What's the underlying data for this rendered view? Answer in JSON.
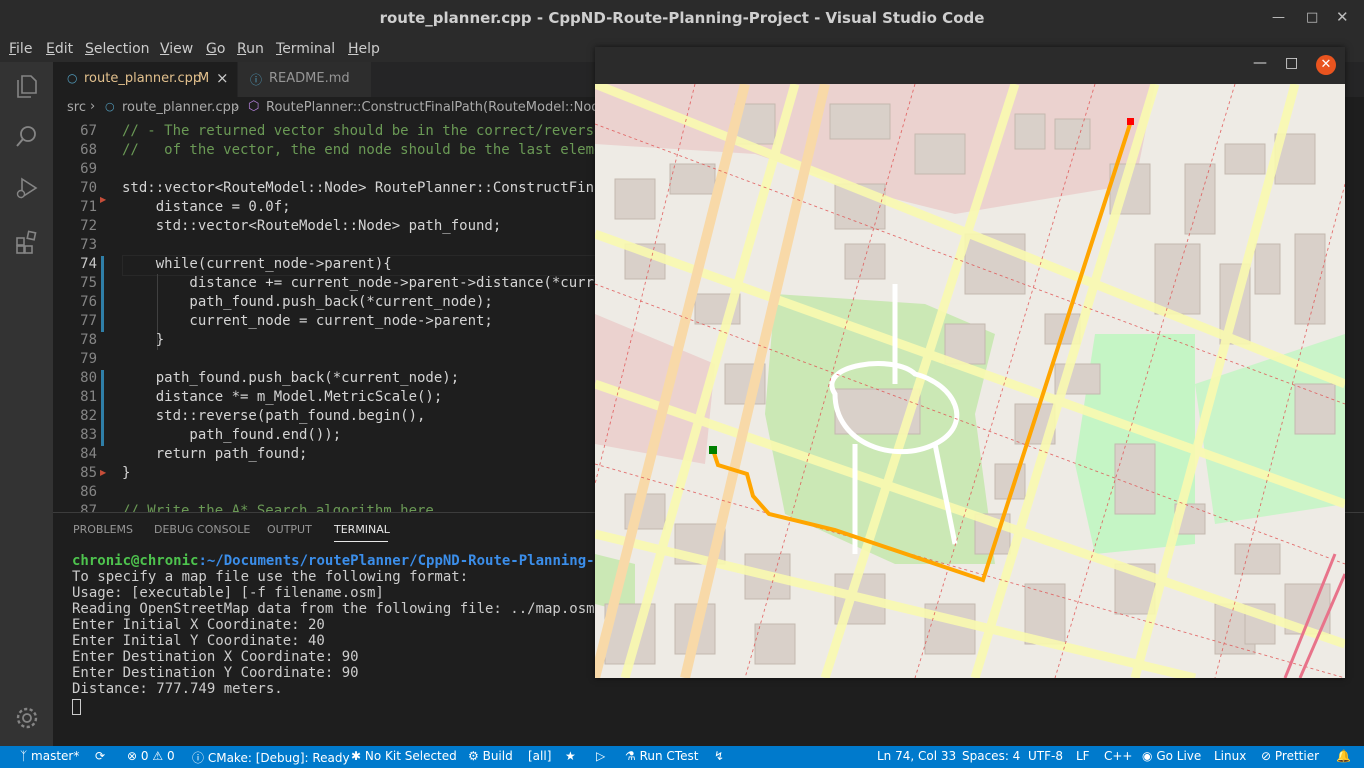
{
  "window": {
    "title": "route_planner.cpp - CppND-Route-Planning-Project - Visual Studio Code"
  },
  "menu": [
    {
      "first": "F",
      "rest": "ile"
    },
    {
      "first": "E",
      "rest": "dit"
    },
    {
      "first": "S",
      "rest": "election"
    },
    {
      "first": "V",
      "rest": "iew"
    },
    {
      "first": "G",
      "rest": "o"
    },
    {
      "first": "R",
      "rest": "un"
    },
    {
      "first": "T",
      "rest": "erminal"
    },
    {
      "first": "H",
      "rest": "elp"
    }
  ],
  "tabs": [
    {
      "label": "route_planner.cpp",
      "badge": "M",
      "close": "×"
    },
    {
      "label": "README.md"
    }
  ],
  "breadcrumb": {
    "folder": "src",
    "file": "route_planner.cpp",
    "symbol": "RoutePlanner::ConstructFinalPath(RouteModel::Node *)"
  },
  "code_lines": [
    {
      "n": "67",
      "text": "// - The returned vector should be in the correct/reverse order"
    },
    {
      "n": "68",
      "text": "//   of the vector, the end node should be the last element"
    },
    {
      "n": "69",
      "text": ""
    },
    {
      "n": "70",
      "text": "std::vector<RouteModel::Node> RoutePlanner::ConstructFinalPath"
    },
    {
      "n": "71",
      "text": "    distance = 0.0f;"
    },
    {
      "n": "72",
      "text": "    std::vector<RouteModel::Node> path_found;"
    },
    {
      "n": "73",
      "text": ""
    },
    {
      "n": "74",
      "text": "    while(current_node->parent){"
    },
    {
      "n": "75",
      "text": "        distance += current_node->parent->distance(*current_node"
    },
    {
      "n": "76",
      "text": "        path_found.push_back(*current_node);"
    },
    {
      "n": "77",
      "text": "        current_node = current_node->parent;"
    },
    {
      "n": "78",
      "text": "    }"
    },
    {
      "n": "79",
      "text": ""
    },
    {
      "n": "80",
      "text": "    path_found.push_back(*current_node);"
    },
    {
      "n": "81",
      "text": "    distance *= m_Model.MetricScale();"
    },
    {
      "n": "82",
      "text": "    std::reverse(path_found.begin(),"
    },
    {
      "n": "83",
      "text": "        path_found.end());"
    },
    {
      "n": "84",
      "text": "    return path_found;"
    },
    {
      "n": "85",
      "text": "}"
    },
    {
      "n": "86",
      "text": ""
    },
    {
      "n": "87",
      "text": "// Write the A* Search algorithm here."
    }
  ],
  "panel": {
    "tabs": [
      "PROBLEMS",
      "DEBUG CONSOLE",
      "OUTPUT",
      "TERMINAL"
    ],
    "active": "TERMINAL"
  },
  "terminal": {
    "prompt_user": "chronic@chronic",
    "prompt_path": ":~/Documents/routePlanner/CppND-Route-Planning-Project/build$ ./OSM_A_star_search",
    "lines": [
      "To specify a map file use the following format:",
      "Usage: [executable] [-f filename.osm]",
      "Reading OpenStreetMap data from the following file: ../map.osm",
      "Enter Initial X Coordinate: 20",
      "Enter Initial Y Coordinate: 40",
      "Enter Destination X Coordinate: 90",
      "Enter Destination Y Coordinate: 90",
      "Distance: 777.749 meters."
    ]
  },
  "status": {
    "branch": "master*",
    "errors": "0",
    "warnings": "0",
    "cmake": "CMake: [Debug]: Ready",
    "kit": "No Kit Selected",
    "build": "Build",
    "target": "[all]",
    "ctest": "Run CTest",
    "position": "Ln 74, Col 33",
    "spaces": "Spaces: 4",
    "encoding": "UTF-8",
    "eol": "LF",
    "language": "C++",
    "golive": "Go Live",
    "os": "Linux",
    "prettier": "Prettier"
  },
  "colors": {
    "accent": "#007acc",
    "route": "#ffa500",
    "start_marker": "#008000",
    "end_marker": "#ff0000"
  }
}
